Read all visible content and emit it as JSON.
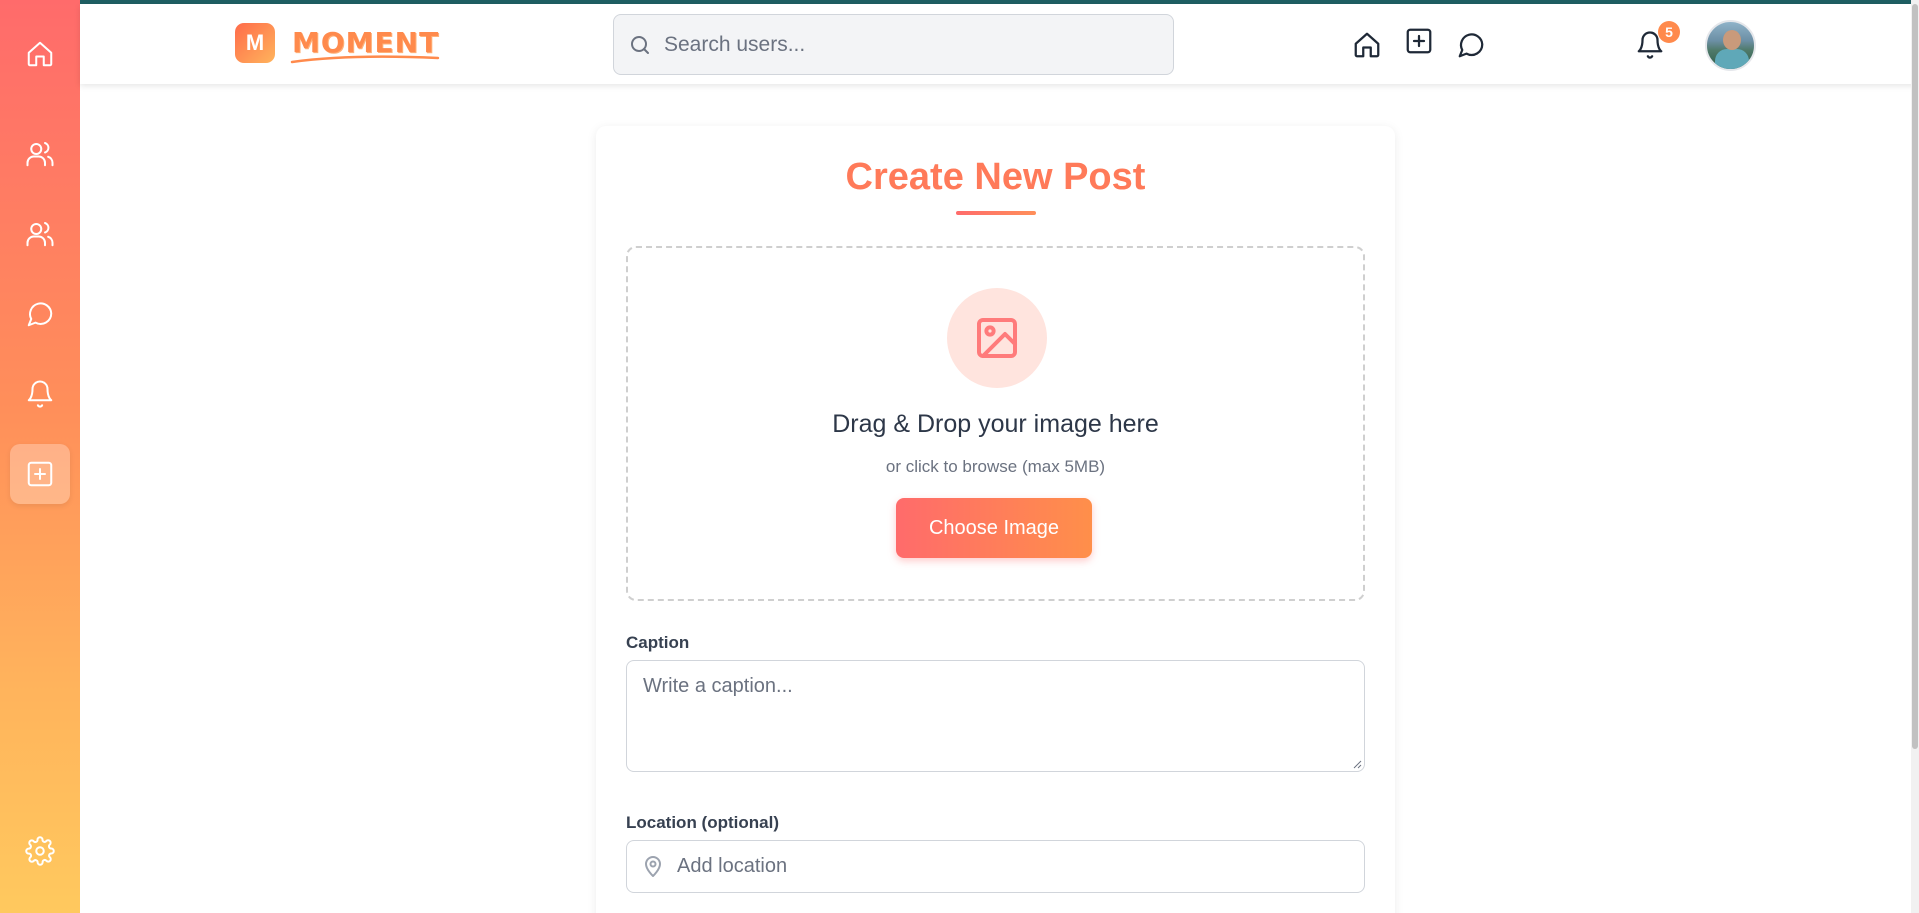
{
  "brand": {
    "logo_letter": "M",
    "name": "MOMENT",
    "primary_color": "#ff6b6b",
    "accent_color": "#ff8a4c"
  },
  "sidebar": {
    "items": [
      {
        "name": "home",
        "icon": "home-icon"
      },
      {
        "name": "friends",
        "icon": "users-icon"
      },
      {
        "name": "groups",
        "icon": "users-icon"
      },
      {
        "name": "messages",
        "icon": "chat-icon"
      },
      {
        "name": "notifications",
        "icon": "bell-icon"
      },
      {
        "name": "create",
        "icon": "plus-square-icon",
        "active": true
      },
      {
        "name": "settings",
        "icon": "gear-icon"
      }
    ]
  },
  "header": {
    "search_placeholder": "Search users...",
    "icons": [
      "home-icon",
      "plus-square-icon",
      "chat-icon",
      "bell-icon"
    ],
    "notification_count": "5"
  },
  "post_form": {
    "title": "Create New Post",
    "dropzone": {
      "title": "Drag & Drop your image here",
      "subtitle": "or click to browse (max 5MB)",
      "button_label": "Choose Image"
    },
    "caption": {
      "label": "Caption",
      "placeholder": "Write a caption..."
    },
    "location": {
      "label": "Location (optional)",
      "placeholder": "Add location"
    }
  }
}
